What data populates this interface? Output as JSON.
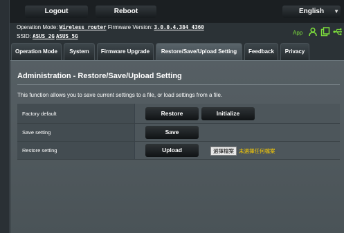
{
  "topbar": {
    "logout_label": "Logout",
    "reboot_label": "Reboot",
    "language": "English"
  },
  "info": {
    "operation_mode_label": "Operation Mode:",
    "operation_mode_value": "Wireless router",
    "firmware_label": "Firmware Version:",
    "firmware_value": "3.0.0.4.384_4360",
    "ssid_label": "SSID:",
    "ssid_2g": "ASUS_2G",
    "ssid_5g": "ASUS_5G",
    "app_label": "App",
    "icons": [
      "person-icon",
      "copy-icon",
      "usb-icon"
    ],
    "icon_color": "#7cdc3c"
  },
  "tabs": [
    {
      "label": "Operation Mode",
      "active": false
    },
    {
      "label": "System",
      "active": false
    },
    {
      "label": "Firmware Upgrade",
      "active": false
    },
    {
      "label": "Restore/Save/Upload Setting",
      "active": true
    },
    {
      "label": "Feedback",
      "active": false
    },
    {
      "label": "Privacy",
      "active": false
    }
  ],
  "panel": {
    "title": "Administration - Restore/Save/Upload Setting",
    "description": "This function allows you to save current settings to a file, or load settings from a file."
  },
  "settings": {
    "factory_default_label": "Factory default",
    "restore_button": "Restore",
    "initialize_button": "Initialize",
    "save_setting_label": "Save setting",
    "save_button": "Save",
    "restore_setting_label": "Restore setting",
    "upload_button": "Upload",
    "choose_file_button": "選擇檔案",
    "no_file_text": "未選擇任何檔案",
    "no_file_color": "#ffd000"
  }
}
